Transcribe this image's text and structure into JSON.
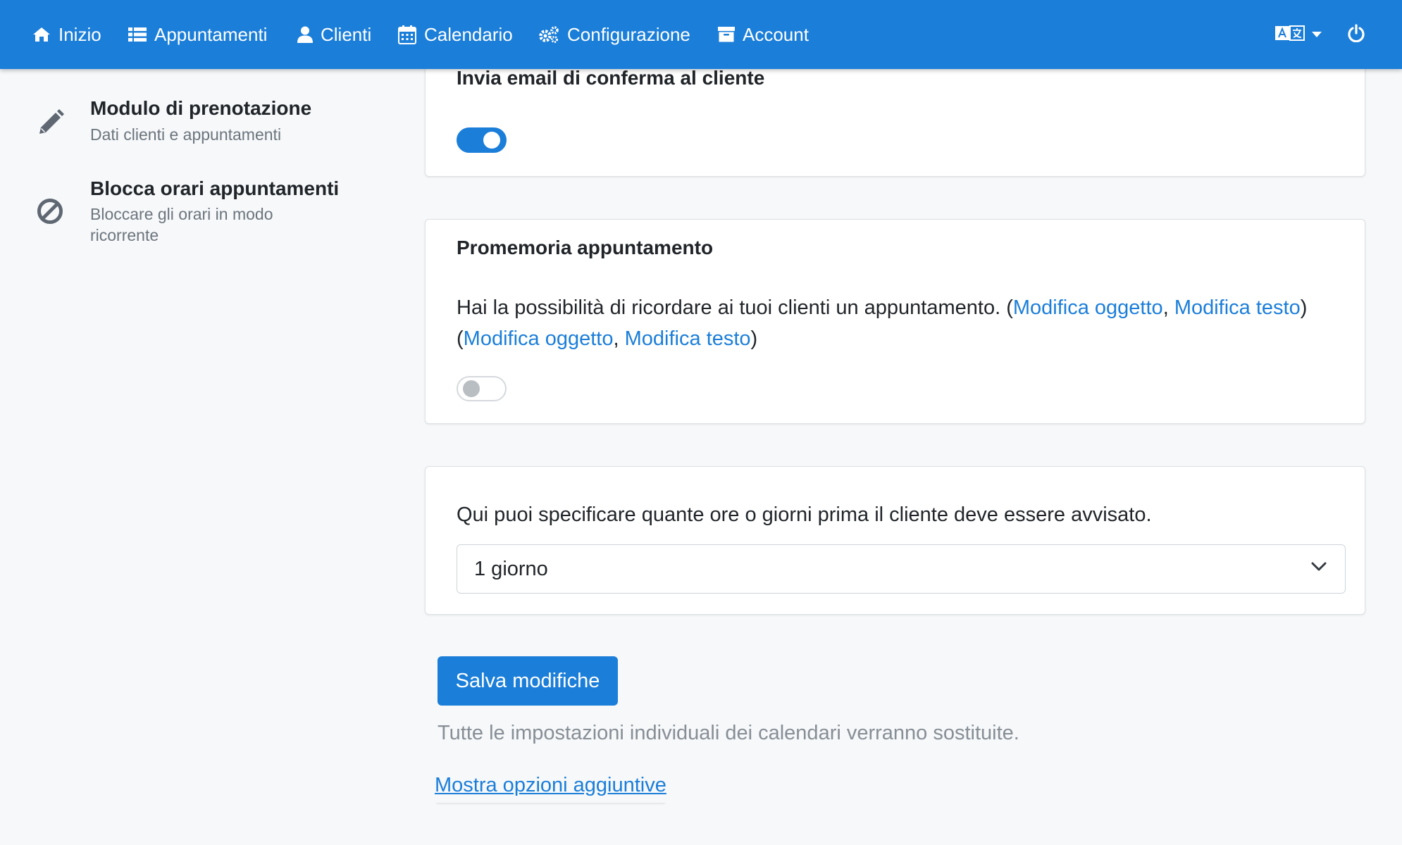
{
  "nav": {
    "items": [
      {
        "label": "Inizio",
        "icon": "home-icon"
      },
      {
        "label": "Appuntamenti",
        "icon": "list-icon"
      },
      {
        "label": "Clienti",
        "icon": "user-icon"
      },
      {
        "label": "Calendario",
        "icon": "calendar-icon"
      },
      {
        "label": "Configurazione",
        "icon": "cogs-icon"
      },
      {
        "label": "Account",
        "icon": "archive-icon"
      }
    ],
    "language_icon": "language-icon",
    "power_icon": "power-icon"
  },
  "sidebar": {
    "items": [
      {
        "title": "Modulo di prenotazione",
        "subtitle": "Dati clienti e appuntamenti",
        "icon": "pencil-icon"
      },
      {
        "title": "Blocca orari appuntamenti",
        "subtitle": "Bloccare gli orari in modo ricorrente",
        "icon": "ban-icon"
      }
    ]
  },
  "confirmation_card": {
    "title": "Invia email di conferma al cliente",
    "toggle_on": true
  },
  "reminder_card": {
    "title": "Promemoria appuntamento",
    "text": "Hai la possibilità di ricordare ai tuoi clienti un appuntamento.",
    "link_subject": "Modifica oggetto",
    "link_text": "Modifica testo",
    "toggle_on": false
  },
  "timing_card": {
    "text": "Qui puoi specificare quante ore o giorni prima il cliente deve essere avvisato.",
    "select_value": "1 giorno"
  },
  "actions": {
    "save_label": "Salva modifiche",
    "note": "Tutte le impostazioni individuali dei calendari verranno sostituite.",
    "more_options_label": "Mostra opzioni aggiuntive"
  },
  "colors": {
    "primary": "#1b7ed9",
    "background": "#f6f8fa",
    "muted_text": "#878e95"
  }
}
